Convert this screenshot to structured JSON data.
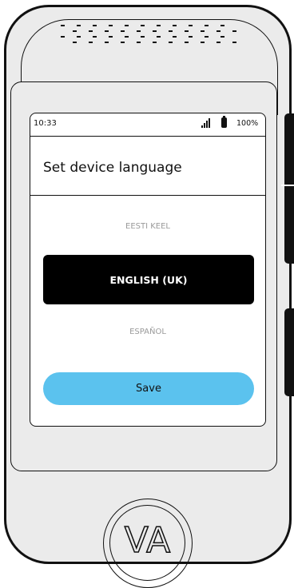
{
  "status_bar": {
    "time": "10:33",
    "battery_percent": "100%",
    "signal_icon": "signal-bars-icon",
    "battery_icon": "battery-icon"
  },
  "header": {
    "title": "Set device language"
  },
  "languages": {
    "previous": "EESTI KEEL",
    "selected": "ENGLISH (UK)",
    "next": "ESPAÑOL"
  },
  "actions": {
    "save_label": "Save",
    "save_color": "#5bc2ee"
  },
  "device": {
    "logo_text": "VA"
  }
}
